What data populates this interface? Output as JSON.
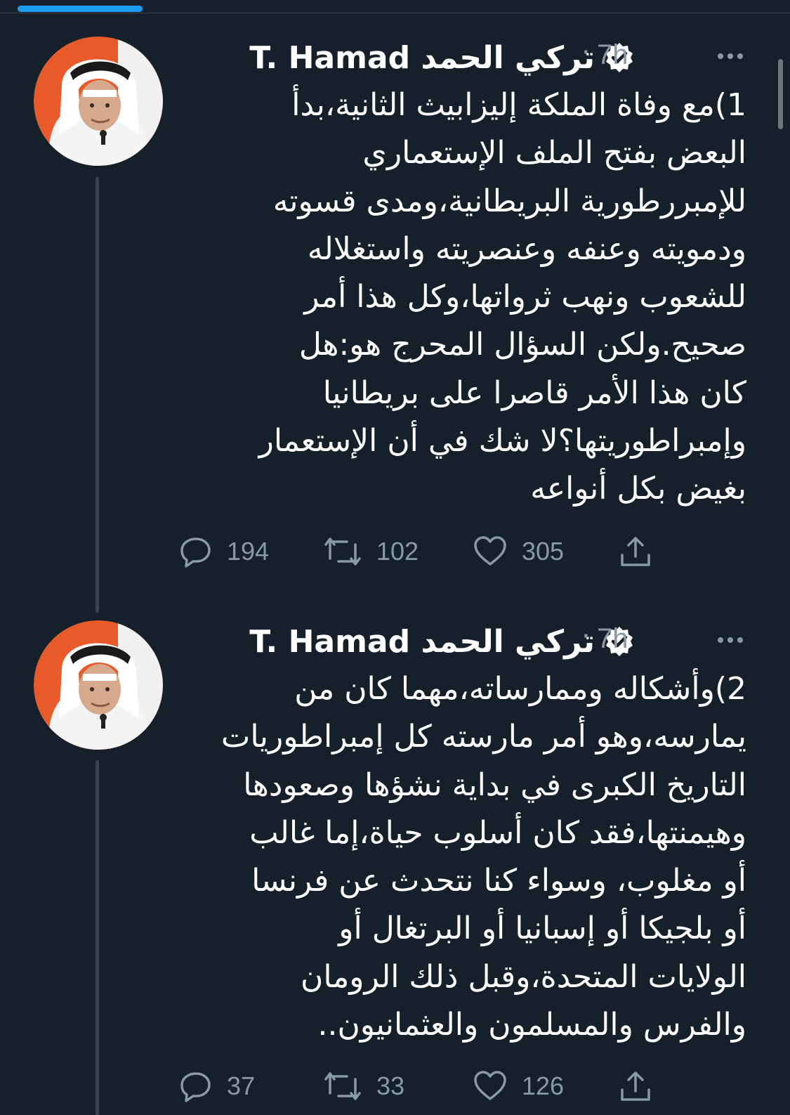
{
  "tweets": [
    {
      "author_name": "تركي الحمد T. Hamad",
      "timestamp": "7h",
      "separator": "·",
      "body_lines": [
        "1)مع وفاة الملكة إليزابيث الثانية،بدأ",
        "البعض بفتح الملف الإستعماري",
        "للإمبررطورية البريطانية،ومدى قسوته",
        "ودمويته وعنفه وعنصريته واستغلاله",
        "للشعوب ونهب ثرواتها،وكل هذا أمر",
        "صحيح.ولكن السؤال المحرج هو:هل",
        "كان هذا الأمر قاصرا على بريطانيا",
        "وإمبراطوريتها؟لا شك في أن الإستعمار",
        "بغيض بكل أنواعه"
      ],
      "replies": "194",
      "retweets": "102",
      "likes": "305"
    },
    {
      "author_name": "تركي الحمد T. Hamad",
      "timestamp": "7h",
      "separator": "·",
      "body_lines": [
        "2)وأشكاله وممارساته،مهما كان من",
        "يمارسه،وهو أمر مارسته كل إمبراطوريات",
        "التاريخ الكبرى في بداية نشؤها وصعودها",
        "وهيمنتها،فقد كان أسلوب حياة،إما غالب",
        "أو مغلوب، وسواء كنا نتحدث عن فرنسا",
        "أو بلجيكا أو إسبانيا أو البرتغال أو",
        "الولايات المتحدة،وقبل ذلك الرومان",
        "والفرس والمسلمون والعثمانيون.."
      ],
      "replies": "37",
      "retweets": "33",
      "likes": "126"
    }
  ],
  "icons": {
    "verified": "verified-badge-icon",
    "more": "more-options-icon",
    "reply": "reply-icon",
    "retweet": "retweet-icon",
    "like": "like-icon",
    "share": "share-icon"
  },
  "colors": {
    "background": "#15202b",
    "text": "#ffffff",
    "secondary": "#8b98a5",
    "accent": "#1d9bf0",
    "thread_line": "#38444d"
  }
}
